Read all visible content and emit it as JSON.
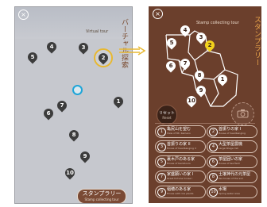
{
  "virtual_tour": {
    "close_icon": "×",
    "label": "Virtual tour",
    "title": "バーチャル探索",
    "stamp_button": {
      "label": "スタンプラリー",
      "sublabel": "Stamp collecting tour"
    },
    "pins": [
      "1",
      "2",
      "3",
      "4",
      "5",
      "6",
      "7",
      "8",
      "9",
      "10"
    ]
  },
  "stamp_rally": {
    "close_icon": "×",
    "label": "Stamp collecting tour",
    "title": "スタンプラリー",
    "reset": {
      "label": "リセット",
      "sublabel": "Reset"
    },
    "camera_icon": "camera-icon",
    "pins": [
      "1",
      "2",
      "3",
      "4",
      "5",
      "6",
      "7",
      "8",
      "9",
      "10"
    ],
    "collected_pin": "2",
    "items": [
      {
        "num": "1",
        "title": "亀尻山を望む",
        "sub": "View of Mt. Kameno"
      },
      {
        "num": "2",
        "title": "首振りの家 I",
        "sub": "House of headbanging"
      },
      {
        "num": "3",
        "title": "首振りの家 II",
        "sub": "House of headbanging II"
      },
      {
        "num": "4",
        "title": "大型茶屋農機",
        "sub": "Large tillage mill"
      },
      {
        "num": "5",
        "title": "裏木戸のある家",
        "sub": "House of backdoors"
      },
      {
        "num": "6",
        "title": "茶屋囲いの家",
        "sub": "House of tea field"
      },
      {
        "num": "7",
        "title": "家盛願いの家 I",
        "sub": "Great fortune house I"
      },
      {
        "num": "8",
        "title": "土壌神代の元茶屋",
        "sub": "Tea house of the soil"
      },
      {
        "num": "9",
        "title": "稲穂のある家",
        "sub": "House with rice plants"
      },
      {
        "num": "10",
        "title": "水場",
        "sub": "Spring water area"
      }
    ]
  },
  "colors": {
    "panel_brown": "#6b3f2c",
    "accent_gold": "#e8b830",
    "position_blue": "#1fa5d8"
  }
}
